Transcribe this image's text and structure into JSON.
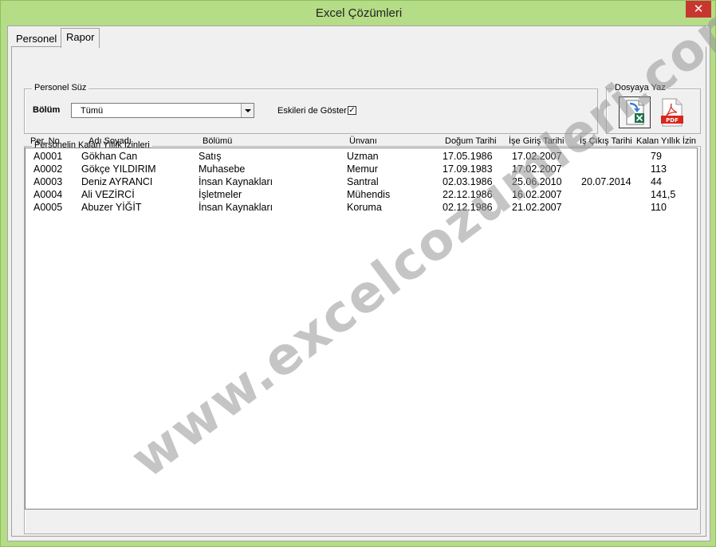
{
  "window": {
    "title": "Excel Çözümleri",
    "close_label": "✕"
  },
  "tabs": [
    {
      "label": "Personel",
      "selected": false
    },
    {
      "label": "Rapor",
      "selected": true
    }
  ],
  "filter": {
    "group_label": "Personel Süz",
    "department_label": "Bölüm",
    "department_value": "Tümü",
    "show_former_label": "Eskileri de Göster",
    "show_former_checked": true,
    "checkmark": "✓"
  },
  "export": {
    "group_label": "Dosyaya Yaz",
    "buttons": [
      {
        "name": "export-excel-button",
        "icon": "excel-icon"
      },
      {
        "name": "export-pdf-button",
        "icon": "pdf-icon",
        "text": "PDF"
      }
    ]
  },
  "report": {
    "group_label": "Personelin Kalan Yıllık İzinleri",
    "columns": [
      "Per. No",
      "Adı Soyadı",
      "Bölümü",
      "Ünvanı",
      "Doğum Tarihi",
      "İşe Giriş Tarihi",
      "İş Çıkış Tarihi",
      "Kalan Yıllık İzin"
    ],
    "rows": [
      [
        "A0001",
        "Gökhan Can",
        "Satış",
        "Uzman",
        "17.05.1986",
        "17.02.2007",
        "",
        "79"
      ],
      [
        "A0002",
        "Gökçe YILDIRIM",
        "Muhasebe",
        "Memur",
        "17.09.1983",
        "17.02.2007",
        "",
        "113"
      ],
      [
        "A0003",
        "Deniz AYRANCI",
        "İnsan Kaynakları",
        "Santral",
        "02.03.1986",
        "25.06.2010",
        "20.07.2014",
        "44"
      ],
      [
        "A0004",
        "Ali VEZİRCİ",
        "İşletmeler",
        "Mühendis",
        "22.12.1986",
        "16.02.2007",
        "",
        "141,5"
      ],
      [
        "A0005",
        "Abuzer YİĞİT",
        "İnsan Kaynakları",
        "Koruma",
        "02.12.1986",
        "21.02.2007",
        "",
        "110"
      ]
    ]
  },
  "watermark": "www.excelcozumleri.com",
  "colors": {
    "frame": "#b5dc86",
    "close": "#c7372f",
    "pdf_red": "#d9261c",
    "excel_green": "#1e7145"
  }
}
